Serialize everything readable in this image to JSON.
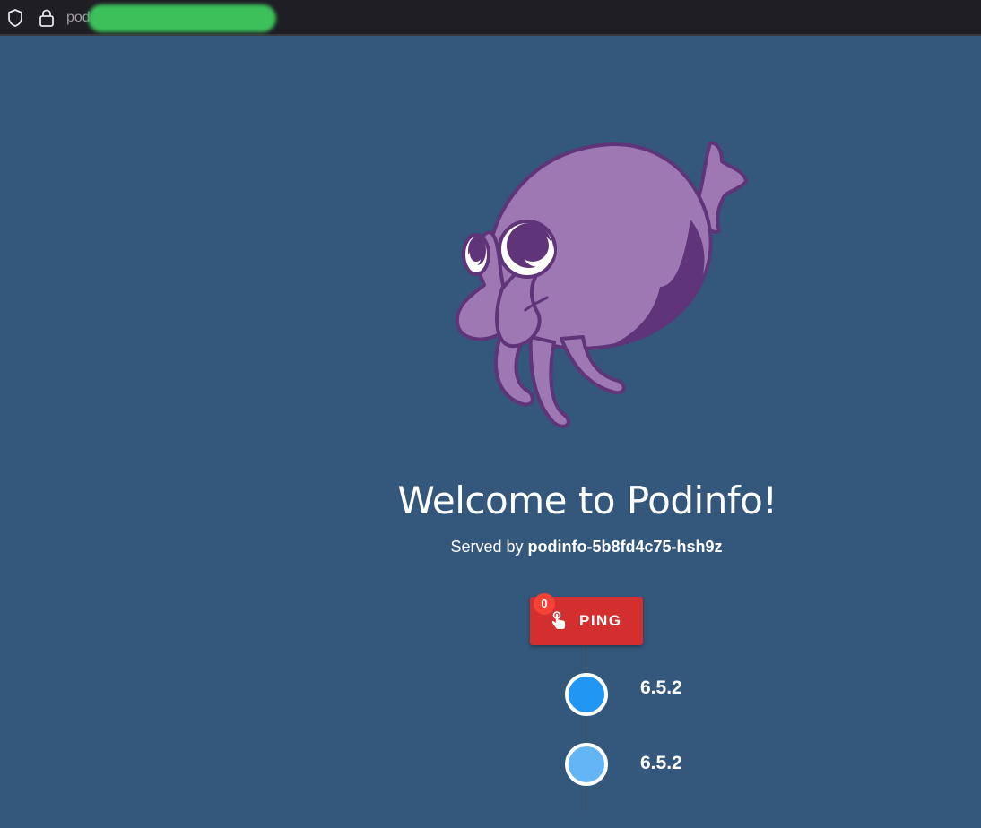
{
  "browser": {
    "url_text": "pod",
    "shield_icon": "shield-icon",
    "lock_icon": "lock-icon"
  },
  "main": {
    "mascot_icon": "podinfo-cuttlefish-logo",
    "title": "Welcome to Podinfo!",
    "served_by_prefix": "Served by",
    "hostname": "podinfo-5b8fd4c75-hsh9z",
    "ping_button": {
      "label": "PING",
      "badge_count": "0",
      "icon": "touch-app-icon"
    },
    "versions": [
      {
        "label": "6.5.2",
        "color": "#2196f3"
      },
      {
        "label": "6.5.2",
        "color": "#64b5f6"
      }
    ]
  },
  "colors": {
    "background": "#34587c",
    "button": "#d32f2f",
    "badge": "#f44336"
  }
}
